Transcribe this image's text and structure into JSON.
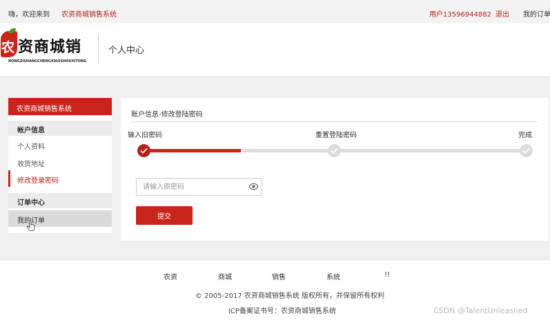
{
  "topbar": {
    "welcome": "嗨，欢迎来到",
    "site_link": "农资商城销售系统",
    "user": "用户13596944882",
    "logout": "退出",
    "my_orders": "我的订单"
  },
  "header": {
    "logo_text": "资商城销",
    "logo_mark_char": "农",
    "logo_pinyin": "NONGZISHANGCHENGXIAOSHOUXITONG",
    "page_title": "个人中心"
  },
  "sidebar": {
    "header": "农资商城销售系统",
    "groups": [
      {
        "title": "帐户信息",
        "items": [
          {
            "label": "个人资料"
          },
          {
            "label": "收货地址"
          },
          {
            "label": "修改登录密码",
            "active": true
          }
        ]
      },
      {
        "title": "订单中心",
        "items": [
          {
            "label": "我的订单",
            "hover": true
          }
        ]
      }
    ]
  },
  "content": {
    "title": "账户信息-修改登陆密码",
    "steps": [
      {
        "label": "输入旧密码",
        "done": true
      },
      {
        "label": "重置登陆密码",
        "done": false
      },
      {
        "label": "完成",
        "done": false
      }
    ],
    "progress_fraction": 0.25,
    "password_input": {
      "placeholder": "请输入原密码",
      "value": ""
    },
    "submit_label": "提交"
  },
  "footer": {
    "links": [
      "农资",
      "商城",
      "销售",
      "系统",
      "!!"
    ],
    "copyright": "© 2005-2017 农资商城销售系统 版权所有，并保留所有权利",
    "icp": "ICP备案证书号：农资商城销售系统",
    "watermark": "CSDN @TalentUnleashed"
  },
  "colors": {
    "accent": "#c9241c",
    "link": "#b7211a",
    "page_bg": "#f0f0f0"
  },
  "icons": [
    "check-icon",
    "eye-icon",
    "hand-cursor-icon"
  ]
}
